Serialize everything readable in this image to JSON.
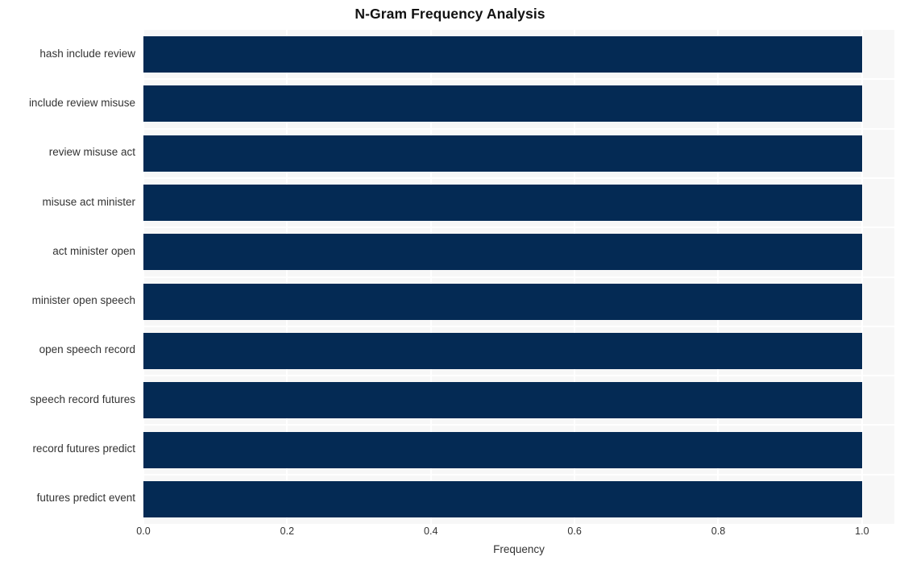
{
  "chart_data": {
    "type": "bar",
    "orientation": "horizontal",
    "title": "N-Gram Frequency Analysis",
    "xlabel": "Frequency",
    "ylabel": "",
    "categories": [
      "hash include review",
      "include review misuse",
      "review misuse act",
      "misuse act minister",
      "act minister open",
      "minister open speech",
      "open speech record",
      "speech record futures",
      "record futures predict",
      "futures predict event"
    ],
    "values": [
      1.0,
      1.0,
      1.0,
      1.0,
      1.0,
      1.0,
      1.0,
      1.0,
      1.0,
      1.0
    ],
    "xlim": [
      0.0,
      1.045
    ],
    "xticks": [
      0.0,
      0.2,
      0.4,
      0.6,
      0.8,
      1.0
    ],
    "xtick_labels": [
      "0.0",
      "0.2",
      "0.4",
      "0.6",
      "0.8",
      "1.0"
    ],
    "grid": true,
    "legend": false,
    "colors": {
      "bar": "#042a54",
      "plot_background": "#f7f7f7",
      "figure_background": "#ffffff",
      "gridline": "#ffffff",
      "tick_label": "#333333",
      "title": "#121212"
    }
  }
}
